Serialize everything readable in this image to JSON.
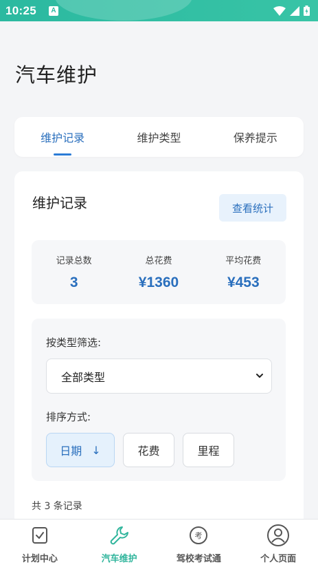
{
  "status": {
    "time": "10:25",
    "notif_letter": "A"
  },
  "page": {
    "title": "汽车维护"
  },
  "tabs": [
    {
      "label": "维护记录",
      "active": true
    },
    {
      "label": "维护类型",
      "active": false
    },
    {
      "label": "保养提示",
      "active": false
    }
  ],
  "records": {
    "title": "维护记录",
    "stats_button": "查看统计",
    "summary": {
      "total_label": "记录总数",
      "total_value": "3",
      "cost_label": "总花费",
      "cost_value": "¥1360",
      "avg_label": "平均花费",
      "avg_value": "¥453"
    },
    "filter": {
      "type_label": "按类型筛选:",
      "type_selected": "全部类型",
      "sort_label": "排序方式:",
      "sort_options": [
        "日期",
        "花费",
        "里程"
      ],
      "sort_arrow": "↓"
    },
    "count_text": "共 3 条记录"
  },
  "nav": [
    {
      "label": "计划中心",
      "icon": "checklist-icon"
    },
    {
      "label": "汽车维护",
      "icon": "wrench-icon"
    },
    {
      "label": "驾校考试通",
      "icon": "exam-icon"
    },
    {
      "label": "个人页面",
      "icon": "person-icon"
    }
  ],
  "colors": {
    "accent": "#2a6fbd",
    "brand": "#30b59c"
  }
}
